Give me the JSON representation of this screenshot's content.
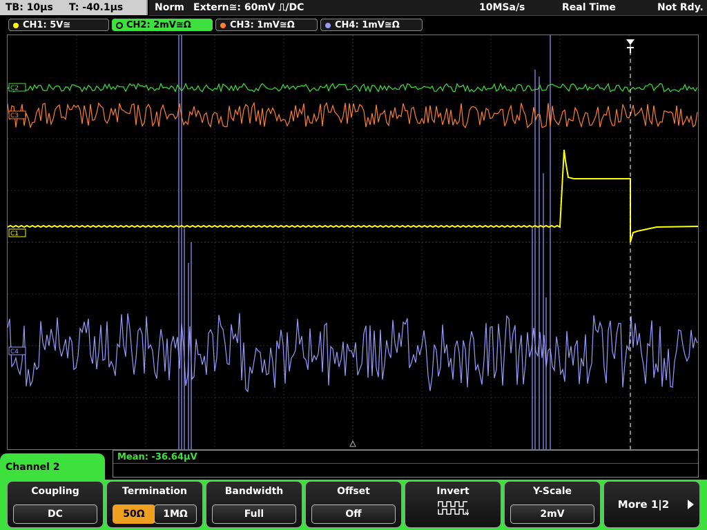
{
  "status": {
    "tb": "TB: 10µs",
    "trigger_time": "T: -40.1µs",
    "mode": "Norm",
    "trigger_source": "Extern≅: 60mV ⎍/DC",
    "sample_rate": "10MSa/s",
    "acq_mode": "Real Time",
    "state": "Not Rdy."
  },
  "channels": [
    {
      "label": "CH1: 5V≅",
      "color": "#ffff00"
    },
    {
      "label": "CH2: 2mV≅Ω",
      "color": "#3ee03e"
    },
    {
      "label": "CH3: 1mV≅Ω",
      "color": "#ff8030"
    },
    {
      "label": "CH4: 1mV≅Ω",
      "color": "#9a9aff"
    }
  ],
  "trace_markers": {
    "ch2": "C2",
    "ch3": "C3",
    "ch1": "C1",
    "ch4": "C4"
  },
  "measurement": {
    "label": "Mean: -36.64µV"
  },
  "menu": {
    "title": "Channel 2",
    "coupling": {
      "title": "Coupling",
      "value": "DC"
    },
    "termination": {
      "title": "Termination",
      "opt1": "50Ω",
      "opt2": "1MΩ"
    },
    "bandwidth": {
      "title": "Bandwidth",
      "value": "Full"
    },
    "offset": {
      "title": "Offset",
      "value": "Off"
    },
    "invert": {
      "title": "Invert",
      "icon": "invert-waveform-icon"
    },
    "yscale": {
      "title": "Y-Scale",
      "value": "2mV"
    },
    "more": {
      "title": "More 1|2",
      "icon": "chevron-right-icon"
    }
  },
  "colors": {
    "ch1": "#ffff00",
    "ch2": "#3ee03e",
    "ch3": "#ff8030",
    "ch4": "#9a9aff",
    "accent": "#3ee03e",
    "highlight": "#f0a020"
  }
}
